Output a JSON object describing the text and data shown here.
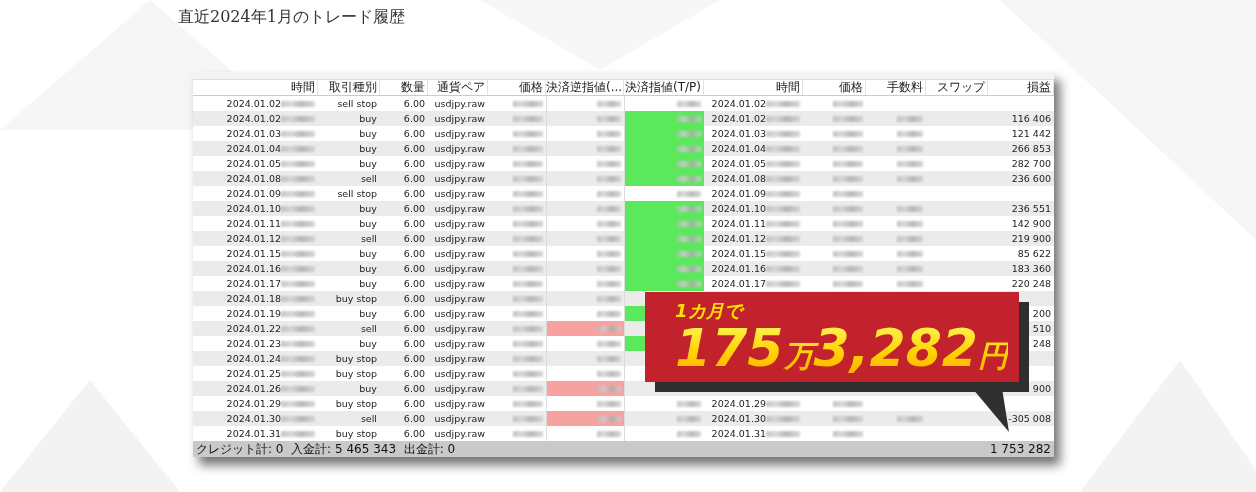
{
  "page_title": "直近2024年1月のトレード履歴",
  "table": {
    "columns": [
      "時間",
      "取引種別",
      "数量",
      "通貨ペア",
      "価格",
      "決済逆指値(...",
      "決済指値(T/P)",
      "時間",
      "価格",
      "手数料",
      "スワップ",
      "損益"
    ],
    "rows": [
      {
        "date": "2024.01.02",
        "type": "sell stop",
        "qty": "6.00",
        "pair": "usdjpy.raw",
        "sl_hit": false,
        "tp_hit": false,
        "close_date": "2024.01.02"
      },
      {
        "date": "2024.01.02",
        "type": "buy",
        "qty": "6.00",
        "pair": "usdjpy.raw",
        "sl_hit": false,
        "tp_hit": true,
        "close_date": "2024.01.02",
        "profit": "116 406"
      },
      {
        "date": "2024.01.03",
        "type": "buy",
        "qty": "6.00",
        "pair": "usdjpy.raw",
        "sl_hit": false,
        "tp_hit": true,
        "close_date": "2024.01.03",
        "profit": "121 442"
      },
      {
        "date": "2024.01.04",
        "type": "buy",
        "qty": "6.00",
        "pair": "usdjpy.raw",
        "sl_hit": false,
        "tp_hit": true,
        "close_date": "2024.01.04",
        "profit": "266 853"
      },
      {
        "date": "2024.01.05",
        "type": "buy",
        "qty": "6.00",
        "pair": "usdjpy.raw",
        "sl_hit": false,
        "tp_hit": true,
        "close_date": "2024.01.05",
        "profit": "282 700"
      },
      {
        "date": "2024.01.08",
        "type": "sell",
        "qty": "6.00",
        "pair": "usdjpy.raw",
        "sl_hit": false,
        "tp_hit": true,
        "close_date": "2024.01.08",
        "profit": "236 600"
      },
      {
        "date": "2024.01.09",
        "type": "sell stop",
        "qty": "6.00",
        "pair": "usdjpy.raw",
        "sl_hit": false,
        "tp_hit": false,
        "close_date": "2024.01.09"
      },
      {
        "date": "2024.01.10",
        "type": "buy",
        "qty": "6.00",
        "pair": "usdjpy.raw",
        "sl_hit": false,
        "tp_hit": true,
        "close_date": "2024.01.10",
        "profit": "236 551"
      },
      {
        "date": "2024.01.11",
        "type": "buy",
        "qty": "6.00",
        "pair": "usdjpy.raw",
        "sl_hit": false,
        "tp_hit": true,
        "close_date": "2024.01.11",
        "profit": "142 900"
      },
      {
        "date": "2024.01.12",
        "type": "sell",
        "qty": "6.00",
        "pair": "usdjpy.raw",
        "sl_hit": false,
        "tp_hit": true,
        "close_date": "2024.01.12",
        "profit": "219 900"
      },
      {
        "date": "2024.01.15",
        "type": "buy",
        "qty": "6.00",
        "pair": "usdjpy.raw",
        "sl_hit": false,
        "tp_hit": true,
        "close_date": "2024.01.15",
        "profit": "85 622"
      },
      {
        "date": "2024.01.16",
        "type": "buy",
        "qty": "6.00",
        "pair": "usdjpy.raw",
        "sl_hit": false,
        "tp_hit": true,
        "close_date": "2024.01.16",
        "profit": "183 360"
      },
      {
        "date": "2024.01.17",
        "type": "buy",
        "qty": "6.00",
        "pair": "usdjpy.raw",
        "sl_hit": false,
        "tp_hit": true,
        "close_date": "2024.01.17",
        "profit": "220 248"
      },
      {
        "date": "2024.01.18",
        "type": "buy stop",
        "qty": "6.00",
        "pair": "usdjpy.raw",
        "sl_hit": false,
        "tp_hit": false
      },
      {
        "date": "2024.01.19",
        "type": "buy",
        "qty": "6.00",
        "pair": "usdjpy.raw",
        "sl_hit": false,
        "tp_hit": true,
        "profit": "200"
      },
      {
        "date": "2024.01.22",
        "type": "sell",
        "qty": "6.00",
        "pair": "usdjpy.raw",
        "sl_hit": true,
        "tp_hit": false,
        "profit": "510"
      },
      {
        "date": "2024.01.23",
        "type": "buy",
        "qty": "6.00",
        "pair": "usdjpy.raw",
        "sl_hit": false,
        "tp_hit": true,
        "profit": "248"
      },
      {
        "date": "2024.01.24",
        "type": "buy stop",
        "qty": "6.00",
        "pair": "usdjpy.raw",
        "sl_hit": false,
        "tp_hit": false
      },
      {
        "date": "2024.01.25",
        "type": "buy stop",
        "qty": "6.00",
        "pair": "usdjpy.raw",
        "sl_hit": false,
        "tp_hit": false
      },
      {
        "date": "2024.01.26",
        "type": "buy",
        "qty": "6.00",
        "pair": "usdjpy.raw",
        "sl_hit": true,
        "tp_hit": false,
        "profit": "900"
      },
      {
        "date": "2024.01.29",
        "type": "buy stop",
        "qty": "6.00",
        "pair": "usdjpy.raw",
        "sl_hit": false,
        "tp_hit": false,
        "close_date": "2024.01.29"
      },
      {
        "date": "2024.01.30",
        "type": "sell",
        "qty": "6.00",
        "pair": "usdjpy.raw",
        "sl_hit": true,
        "tp_hit": false,
        "close_date": "2024.01.30",
        "profit": "-305 008"
      },
      {
        "date": "2024.01.31",
        "type": "buy stop",
        "qty": "6.00",
        "pair": "usdjpy.raw",
        "sl_hit": false,
        "tp_hit": false,
        "close_date": "2024.01.31"
      }
    ],
    "footer": {
      "summary": "クレジット計: 0  入金計: 5 465 343  出金計: 0",
      "total": "1 753 282"
    }
  },
  "callout": {
    "lead": "1カ月で",
    "amount": [
      {
        "text": "175",
        "kind": "number"
      },
      {
        "text": "万",
        "kind": "unit"
      },
      {
        "text": "3,282",
        "kind": "number"
      },
      {
        "text": "円",
        "kind": "unit"
      }
    ]
  }
}
